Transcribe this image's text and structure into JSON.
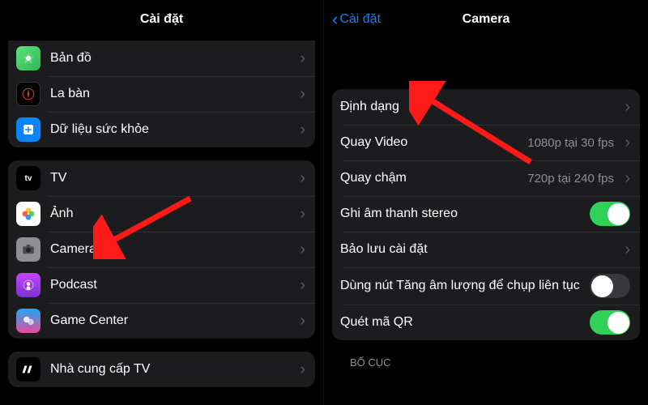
{
  "left": {
    "title": "Cài đặt",
    "group1": [
      {
        "icon": "maps-icon",
        "label": "Bản đồ"
      },
      {
        "icon": "compass-icon",
        "label": "La bàn"
      },
      {
        "icon": "health-icon",
        "label": "Dữ liệu sức khỏe"
      }
    ],
    "group2": [
      {
        "icon": "tv-icon",
        "label": "TV"
      },
      {
        "icon": "photos-icon",
        "label": "Ảnh"
      },
      {
        "icon": "camera-icon",
        "label": "Camera"
      },
      {
        "icon": "podcast-icon",
        "label": "Podcast"
      },
      {
        "icon": "gamecenter-icon",
        "label": "Game Center"
      }
    ],
    "group3": [
      {
        "icon": "tvprovider-icon",
        "label": "Nhà cung cấp TV"
      }
    ]
  },
  "right": {
    "back": "Cài đặt",
    "title": "Camera",
    "rows": {
      "format": {
        "label": "Định dạng"
      },
      "record_video": {
        "label": "Quay Video",
        "value": "1080p tại 30 fps"
      },
      "slomo": {
        "label": "Quay chậm",
        "value": "720p tại 240 fps"
      },
      "stereo": {
        "label": "Ghi âm thanh stereo",
        "on": true
      },
      "preserve": {
        "label": "Bảo lưu cài đặt"
      },
      "volume_burst": {
        "label": "Dùng nút Tăng âm lượng để chụp liên tục",
        "on": false
      },
      "scan_qr": {
        "label": "Quét mã QR",
        "on": true
      }
    },
    "section_layout": "BỐ CỤC"
  },
  "colors": {
    "accent": "#0a84ff",
    "toggle_on": "#30d158",
    "annotation": "#ff1a1a"
  }
}
